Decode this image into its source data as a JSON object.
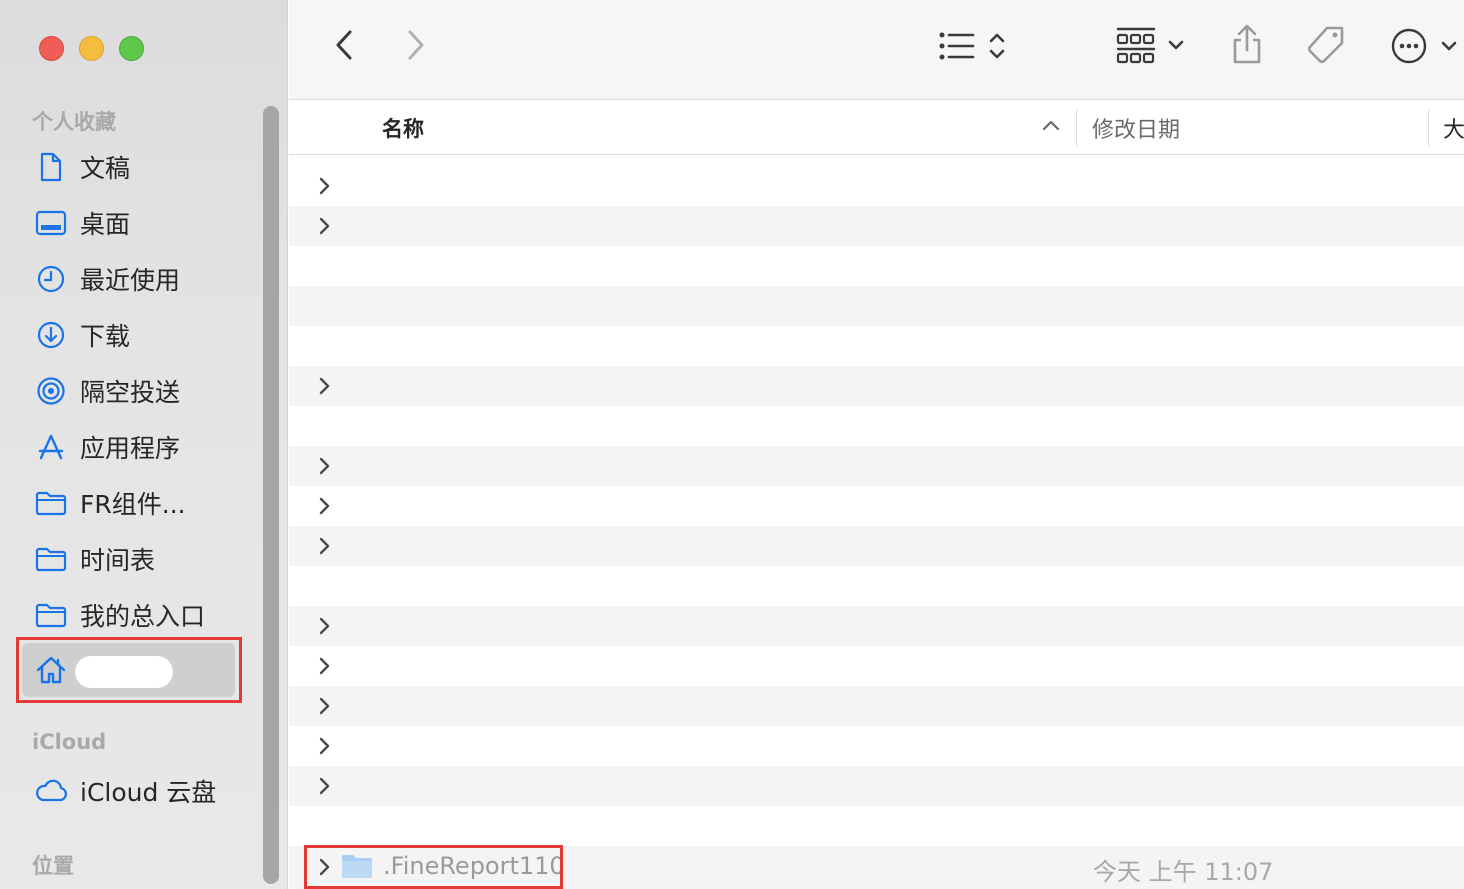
{
  "sidebar": {
    "favorites_heading": "个人收藏",
    "items": [
      {
        "label": "文稿",
        "icon": "document-icon"
      },
      {
        "label": "桌面",
        "icon": "desktop-icon"
      },
      {
        "label": "最近使用",
        "icon": "clock-icon"
      },
      {
        "label": "下载",
        "icon": "download-icon"
      },
      {
        "label": "隔空投送",
        "icon": "airdrop-icon"
      },
      {
        "label": "应用程序",
        "icon": "applications-icon"
      },
      {
        "label": "FR组件...",
        "icon": "folder-icon"
      },
      {
        "label": "时间表",
        "icon": "folder-icon"
      },
      {
        "label": "我的总入口",
        "icon": "folder-icon"
      }
    ],
    "home_item": {
      "icon": "home-icon",
      "selected": true
    },
    "icloud_heading": "iCloud",
    "icloud_item": {
      "label": "iCloud 云盘",
      "icon": "cloud-icon"
    },
    "locations_heading": "位置"
  },
  "toolbar": {
    "back_icon": "chevron-left-icon",
    "forward_icon": "chevron-right-icon",
    "view_icon": "list-view-icon",
    "group_icon": "grid-group-icon",
    "share_icon": "share-icon",
    "tag_icon": "tag-icon",
    "more_icon": "ellipsis-circle-icon"
  },
  "columns": {
    "name": "名称",
    "date": "修改日期",
    "size": "大"
  },
  "rows": [
    {
      "expandable": true
    },
    {
      "expandable": true
    },
    {
      "expandable": false
    },
    {
      "expandable": false
    },
    {
      "expandable": false
    },
    {
      "expandable": true
    },
    {
      "expandable": false
    },
    {
      "expandable": true
    },
    {
      "expandable": true
    },
    {
      "expandable": true
    },
    {
      "expandable": false
    },
    {
      "expandable": true
    },
    {
      "expandable": true
    },
    {
      "expandable": true
    },
    {
      "expandable": true
    },
    {
      "expandable": true
    },
    {
      "expandable": false
    }
  ],
  "highlighted_file": {
    "name": ".FineReport110",
    "date": "今天 上午 11:07"
  },
  "colors": {
    "accent": "#1b73e8",
    "highlight_border": "#e53935",
    "folder": "#a9cdf2"
  }
}
